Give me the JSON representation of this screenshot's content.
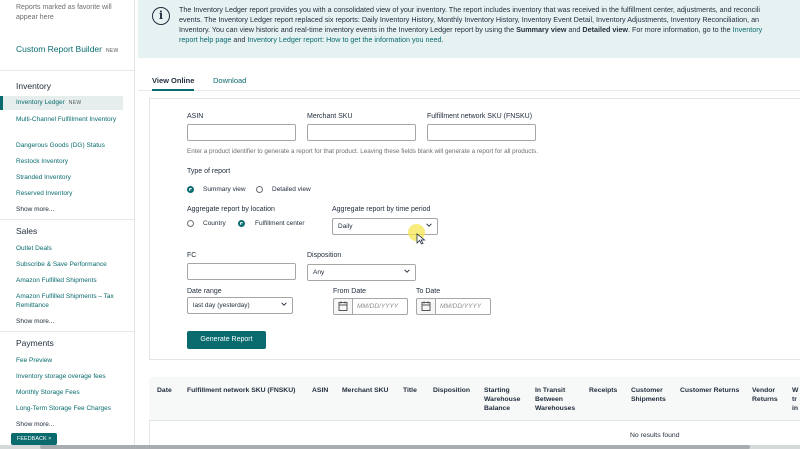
{
  "sidebar": {
    "favorites_note": "Reports marked as favorite will appear here",
    "custom_report_builder": "Custom Report Builder",
    "new_badge": "NEW",
    "sections": {
      "inventory": {
        "title": "Inventory",
        "items": [
          "Inventory Ledger",
          "Multi-Channel Fulfillment Inventory",
          "Dangerous Goods (DG) Status",
          "Restock Inventory",
          "Stranded Inventory",
          "Reserved Inventory"
        ],
        "show_more": "Show more..."
      },
      "sales": {
        "title": "Sales",
        "items": [
          "Outlet Deals",
          "Subscribe & Save Performance",
          "Amazon Fulfilled Shipments",
          "Amazon Fulfilled Shipments – Tax Remittance"
        ],
        "show_more": "Show more..."
      },
      "payments": {
        "title": "Payments",
        "items": [
          "Fee Preview",
          "Inventory storage overage fees",
          "Monthly Storage Fees",
          "Long-Term Storage Fee Charges"
        ],
        "show_more": "Show more..."
      }
    },
    "feedback_label": "FEEDBACK ×"
  },
  "banner": {
    "text_1": "The Inventory Ledger report provides you with a consolidated view of your inventory. The report includes inventory that was received in the fulfillment center, adjustments, and reconcili",
    "text_2": "events. The Inventory Ledger report replaced six reports: Daily Inventory History, Monthly Inventory History, Inventory Event Detail, Inventory Adjustments, Inventory Reconciliation, an",
    "text_3a": "Inventory. You can view historic and real-time inventory events in the Inventory Ledger report by using the ",
    "text_3b": "Summary view",
    "text_3c": " and ",
    "text_3d": "Detailed view",
    "text_3e": ". For more information, go to the ",
    "text_3f": "Inventory",
    "link_1": "report help page",
    "text_4": " and ",
    "link_2": "Inventory Ledger report: How to get the information you need",
    "text_5": "."
  },
  "tabs": {
    "view_online": "View Online",
    "download": "Download"
  },
  "form": {
    "asin_label": "ASIN",
    "asin_value": "",
    "merchant_sku_label": "Merchant SKU",
    "merchant_sku_value": "",
    "fnsku_label": "Fulfillment network SKU (FNSKU)",
    "fnsku_value": "",
    "identifier_hint": "Enter a product identifier to generate a report for that product. Leaving these fields blank will generate a report for all products.",
    "type_label": "Type of report",
    "summary_view": "Summary view",
    "detailed_view": "Detailed view",
    "selected_type": "Summary view",
    "aggregate_location_label": "Aggregate report by location",
    "country": "Country",
    "fulfillment_center": "Fulfillment center",
    "selected_location": "Fulfillment center",
    "aggregate_time_label": "Aggregate report by time period",
    "time_period_value": "Daily",
    "fc_label": "FC",
    "fc_value": "",
    "disposition_label": "Disposition",
    "disposition_value": "Any",
    "date_range_label": "Date range",
    "date_range_value": "last day (yesterday)",
    "from_date_label": "From Date",
    "from_date_placeholder": "MM/DD/YYYY",
    "to_date_label": "To Date",
    "to_date_placeholder": "MM/DD/YYYY",
    "generate_button": "Generate Report"
  },
  "table": {
    "columns": [
      "Date",
      "Fulfillment network SKU (FNSKU)",
      "ASIN",
      "Merchant SKU",
      "Title",
      "Disposition",
      "Starting Warehouse Balance",
      "In Transit Between Warehouses",
      "Receipts",
      "Customer Shipments",
      "Customer Returns",
      "Vendor Returns",
      "W tr in"
    ],
    "empty_message": "No results found"
  },
  "colors": {
    "accent": "#0a6b6e",
    "banner_bg": "#e6f1f1",
    "text": "#232f3e"
  }
}
